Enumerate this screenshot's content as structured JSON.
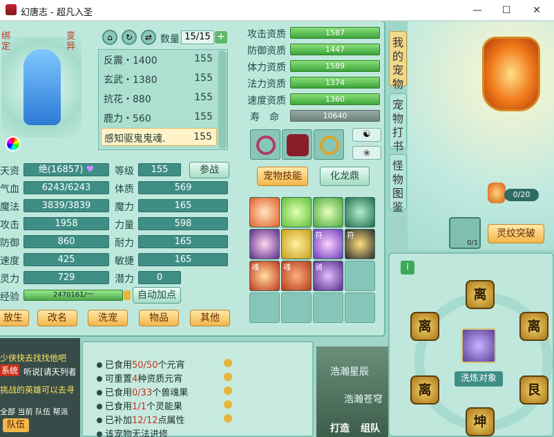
{
  "window": {
    "title": "幻唐志 - 超凡入圣",
    "minimize": "—",
    "maximize": "☐",
    "close": "✕"
  },
  "left": {
    "bind": "绑定",
    "transform": "变异",
    "stats": [
      {
        "label": "天资",
        "value": "绝(16857)",
        "label2": "等级",
        "value2": "155"
      },
      {
        "label": "气血",
        "value": "6243/6243",
        "label2": "体质",
        "value2": "569"
      },
      {
        "label": "魔法",
        "value": "3839/3839",
        "label2": "魔力",
        "value2": "165"
      },
      {
        "label": "攻击",
        "value": "1958",
        "label2": "力量",
        "value2": "598"
      },
      {
        "label": "防御",
        "value": "860",
        "label2": "耐力",
        "value2": "165"
      },
      {
        "label": "速度",
        "value": "425",
        "label2": "敏捷",
        "value2": "165"
      },
      {
        "label": "灵力",
        "value": "729",
        "label2": "潜力",
        "value2": "0"
      }
    ],
    "exp_label": "经验",
    "exp_value": "2470161/一",
    "fight": "参战",
    "autopoint": "自动加点",
    "bottom_buttons": [
      "放生",
      "改名",
      "洗宠",
      "物品",
      "其他"
    ]
  },
  "pets": {
    "count_label": "数量",
    "count": "15/15",
    "list": [
      {
        "name": "反震・1400",
        "lv": "155"
      },
      {
        "name": "玄武・1380",
        "lv": "155"
      },
      {
        "name": "抗花・880",
        "lv": "155"
      },
      {
        "name": "鹿力・560",
        "lv": "155"
      },
      {
        "name": "感知驱鬼鬼魂.",
        "lv": "155"
      }
    ]
  },
  "aptitude": [
    {
      "label": "攻击资质",
      "value": "1587"
    },
    {
      "label": "防御资质",
      "value": "1447"
    },
    {
      "label": "体力资质",
      "value": "1589"
    },
    {
      "label": "法力资质",
      "value": "1374"
    },
    {
      "label": "速度资质",
      "value": "1360"
    },
    {
      "label": "寿　命",
      "value": "10640"
    }
  ],
  "skills": {
    "tab1": "宠物技能",
    "tab2": "化龙鼎",
    "badges": {
      "r3c3": "符",
      "r3c4": "符",
      "r4c1": "魂",
      "r4c2": "魂",
      "r4c3": "骑"
    }
  },
  "side_tabs": [
    "我的宠物",
    "宠物打书",
    "怪物图鉴"
  ],
  "right": {
    "counter": "0/20",
    "break_btn": "灵纹突破",
    "pet_count": "0/1",
    "wash_label": "洗炼对象",
    "gua": [
      "离",
      "离",
      "离",
      "离",
      "艮",
      "坤"
    ]
  },
  "info_lines": [
    {
      "pre": "已食用",
      "hl": "50/50",
      "post": "个元宵"
    },
    {
      "pre": "可重置",
      "hl": "4",
      "post": "种资质元宵"
    },
    {
      "pre": "已食用",
      "hl": "0/33",
      "post": "个兽魂果"
    },
    {
      "pre": "已食用",
      "hl": "1/1",
      "post": "个灵能果"
    },
    {
      "pre": "已补加",
      "hl": "12/12",
      "post": "点属性"
    },
    {
      "pre": "该宠物无法进修",
      "hl": "",
      "post": ""
    }
  ],
  "chat": {
    "line1": "少侠快去找找他吧",
    "sys": "系统",
    "line2": "听说[请天列者",
    "line3": "挑战的英雄可以去寻",
    "channels": "全部 当前 队伍 帮派",
    "team": "队伍"
  },
  "scene": {
    "text1": "浩瀚星辰",
    "text2": "浩瀚苍穹",
    "b1": "打造",
    "b2": "组队"
  }
}
